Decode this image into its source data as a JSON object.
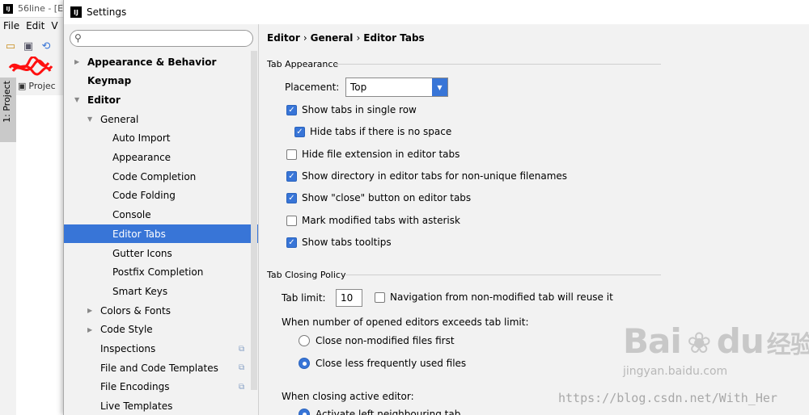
{
  "ide": {
    "window_title": "56line - [E",
    "menu": [
      "File",
      "Edit",
      "V"
    ],
    "side_tab": "1: Project",
    "project_tab": "Projec"
  },
  "dialog": {
    "title": "Settings",
    "search_placeholder": ""
  },
  "tree": {
    "items": [
      {
        "label": "Appearance & Behavior",
        "arrow": "▶",
        "bold": true
      },
      {
        "label": "Keymap",
        "bold": true
      },
      {
        "label": "Editor",
        "arrow": "▼",
        "bold": true
      },
      {
        "label": "General",
        "arrow": "▼"
      },
      {
        "label": "Auto Import"
      },
      {
        "label": "Appearance"
      },
      {
        "label": "Code Completion"
      },
      {
        "label": "Code Folding"
      },
      {
        "label": "Console"
      },
      {
        "label": "Editor Tabs",
        "selected": true
      },
      {
        "label": "Gutter Icons"
      },
      {
        "label": "Postfix Completion"
      },
      {
        "label": "Smart Keys"
      },
      {
        "label": "Colors & Fonts",
        "arrow": "▶"
      },
      {
        "label": "Code Style",
        "arrow": "▶"
      },
      {
        "label": "Inspections",
        "project_icon": true
      },
      {
        "label": "File and Code Templates",
        "project_icon": true
      },
      {
        "label": "File Encodings",
        "project_icon": true
      },
      {
        "label": "Live Templates"
      }
    ]
  },
  "breadcrumb": [
    "Editor",
    "General",
    "Editor Tabs"
  ],
  "tab_appearance": {
    "title": "Tab Appearance",
    "placement_label": "Placement:",
    "placement_value": "Top",
    "options": [
      {
        "label": "Show tabs in single row",
        "checked": true
      },
      {
        "label": "Hide tabs if there is no space",
        "checked": true
      },
      {
        "label": "Hide file extension in editor tabs",
        "checked": false
      },
      {
        "label": "Show directory in editor tabs for non-unique filenames",
        "checked": true
      },
      {
        "label": "Show \"close\" button on editor tabs",
        "checked": true
      },
      {
        "label": "Mark modified tabs with asterisk",
        "checked": false
      },
      {
        "label": "Show tabs tooltips",
        "checked": true
      }
    ]
  },
  "tab_closing": {
    "title": "Tab Closing Policy",
    "tab_limit_label": "Tab limit:",
    "tab_limit_value": "10",
    "navigation_label": "Navigation from non-modified tab will reuse it",
    "navigation_checked": false,
    "exceeds_label": "When number of opened editors exceeds tab limit:",
    "exceed_options": [
      {
        "label": "Close non-modified files first",
        "selected": false
      },
      {
        "label": "Close less frequently used files",
        "selected": true
      }
    ],
    "closing_label": "When closing active editor:",
    "closing_options": [
      {
        "label": "Activate left neighbouring tab",
        "selected": true
      }
    ]
  },
  "watermark": {
    "logo": "Bai",
    "logo_suffix": "du",
    "logo_cn": "经验",
    "domain": "jingyan.baidu.com",
    "url": "https://blog.csdn.net/With_Her"
  }
}
